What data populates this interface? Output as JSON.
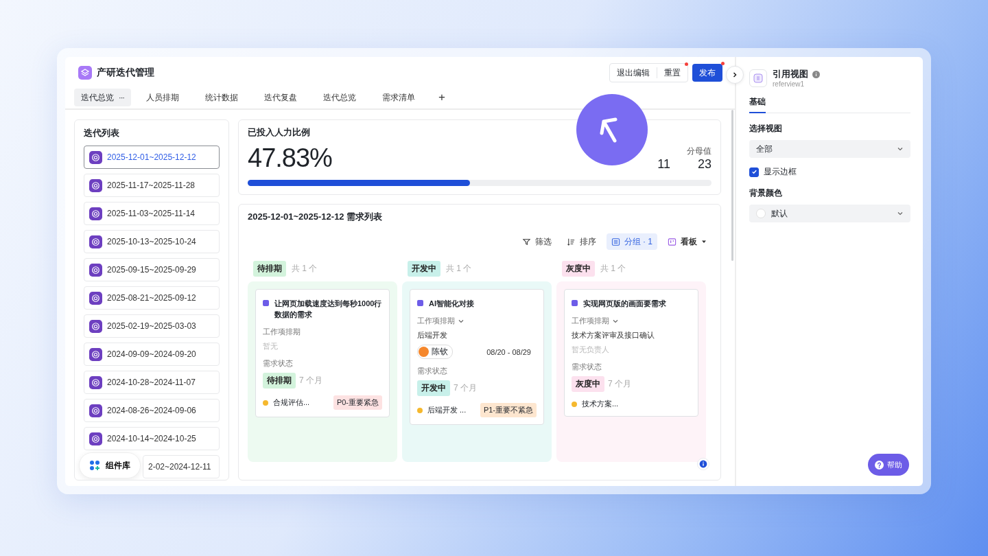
{
  "app": {
    "title": "产研迭代管理"
  },
  "header_buttons": [
    {
      "label": "退出编辑",
      "kind": "plain",
      "badge": false
    },
    {
      "label": "重置",
      "kind": "plain",
      "badge": true
    },
    {
      "label": "发布",
      "kind": "primary",
      "badge": true
    }
  ],
  "tabs": [
    {
      "label": "迭代总览",
      "selected": true,
      "more": "···"
    },
    {
      "label": "人员排期",
      "selected": false
    },
    {
      "label": "统计数据",
      "selected": false
    },
    {
      "label": "迭代复盘",
      "selected": false
    },
    {
      "label": "迭代总览",
      "selected": false
    },
    {
      "label": "需求清单",
      "selected": false
    }
  ],
  "add_tab": "+",
  "iteration_list": {
    "title": "迭代列表",
    "items": [
      {
        "label": "2025-12-01~2025-12-12",
        "selected": true
      },
      {
        "label": "2025-11-17~2025-11-28",
        "selected": false
      },
      {
        "label": "2025-11-03~2025-11-14",
        "selected": false
      },
      {
        "label": "2025-10-13~2025-10-24",
        "selected": false
      },
      {
        "label": "2025-09-15~2025-09-29",
        "selected": false
      },
      {
        "label": "2025-08-21~2025-09-12",
        "selected": false
      },
      {
        "label": "2025-02-19~2025-03-03",
        "selected": false
      },
      {
        "label": "2024-09-09~2024-09-20",
        "selected": false
      },
      {
        "label": "2024-10-28~2024-11-07",
        "selected": false
      },
      {
        "label": "2024-08-26~2024-09-06",
        "selected": false
      },
      {
        "label": "2024-10-14~2024-10-25",
        "selected": false
      },
      {
        "label": "2-02~2024-12-11",
        "selected": false
      }
    ]
  },
  "component_library_button": "组件库",
  "metric": {
    "title": "已投入人力比例",
    "value": "47.83%",
    "numerator": "11",
    "denominator_label": "分母值",
    "denominator": "23",
    "level": 0.48
  },
  "requirements": {
    "title": "2025-12-01~2025-12-12 需求列表",
    "toolbar": [
      {
        "label": "筛选",
        "kind": "filter",
        "selected": false
      },
      {
        "label": "排序",
        "kind": "sort",
        "selected": false
      },
      {
        "label": "分组 · 1",
        "kind": "group",
        "selected": true
      },
      {
        "label": "看板",
        "kind": "board",
        "selected": false
      }
    ],
    "columns": [
      {
        "status": "待排期",
        "count": "共 1 个",
        "color": "#d3f3dc",
        "cards": [
          {
            "title": "让网页加载速度达到每秒1000行数据的需求",
            "schedule_label": "工作项排期",
            "collapsible": false,
            "schedule_value": "暂无",
            "status_label": "需求状态",
            "status": "待排期",
            "age": "7 个月",
            "footer": "合规评估...",
            "priority": "P0-重要紧急",
            "color": "#fde2e2"
          }
        ]
      },
      {
        "status": "开发中",
        "count": "共 1 个",
        "color": "#c8f0ea",
        "cards": [
          {
            "title": "AI智能化对接",
            "schedule_label": "工作项排期",
            "collapsible": true,
            "schedule_task": "后端开发",
            "assignee": "陈钦",
            "dates": "08/20 - 08/29",
            "status_label": "需求状态",
            "status": "开发中",
            "age": "7 个月",
            "footer": "后端开发 ...",
            "priority": "P1-重要不紧急",
            "color": "#fde6cf"
          }
        ]
      },
      {
        "status": "灰度中",
        "count": "共 1 个",
        "color": "#fce1ee",
        "cards": [
          {
            "title": "实现网页版的画面要需求",
            "schedule_label": "工作项排期",
            "collapsible": true,
            "schedule_task": "技术方案评审及接口确认",
            "schedule_value": "暂无负责人",
            "status_label": "需求状态",
            "status": "灰度中",
            "age": "7 个月",
            "footer": "技术方案..."
          }
        ]
      }
    ]
  },
  "panel": {
    "title": "引用视图",
    "subtitle": "referview1",
    "tabs": [
      {
        "label": "基础",
        "selected": true
      }
    ],
    "view_label": "选择视图",
    "view_value": "全部",
    "border_checkbox": {
      "label": "显示边框",
      "checked": true
    },
    "bg_label": "背景颜色",
    "bg_value": "默认"
  },
  "help_button": "帮助"
}
